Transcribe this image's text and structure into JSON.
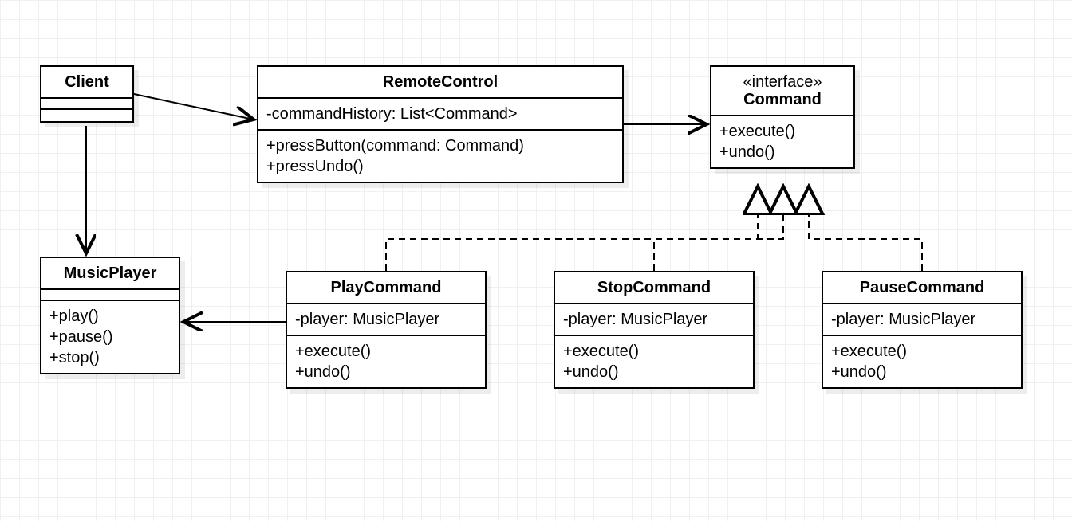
{
  "classes": {
    "client": {
      "name": "Client",
      "attributes": [],
      "methods": []
    },
    "remoteControl": {
      "name": "RemoteControl",
      "attributes": [
        "-commandHistory: List<Command>"
      ],
      "methods": [
        "+pressButton(command: Command)",
        "+pressUndo()"
      ]
    },
    "command": {
      "stereotype": "«interface»",
      "name": "Command",
      "attributes": [],
      "methods": [
        "+execute()",
        "+undo()"
      ]
    },
    "musicPlayer": {
      "name": "MusicPlayer",
      "attributes": [],
      "methods": [
        "+play()",
        "+pause()",
        "+stop()"
      ]
    },
    "playCommand": {
      "name": "PlayCommand",
      "attributes": [
        "-player: MusicPlayer"
      ],
      "methods": [
        "+execute()",
        "+undo()"
      ]
    },
    "stopCommand": {
      "name": "StopCommand",
      "attributes": [
        "-player: MusicPlayer"
      ],
      "methods": [
        "+execute()",
        "+undo()"
      ]
    },
    "pauseCommand": {
      "name": "PauseCommand",
      "attributes": [
        "-player: MusicPlayer"
      ],
      "methods": [
        "+execute()",
        "+undo()"
      ]
    }
  },
  "relationships": [
    {
      "from": "Client",
      "to": "RemoteControl",
      "type": "association",
      "style": "solid-open"
    },
    {
      "from": "Client",
      "to": "MusicPlayer",
      "type": "association",
      "style": "solid-open"
    },
    {
      "from": "RemoteControl",
      "to": "Command",
      "type": "association",
      "style": "solid-open"
    },
    {
      "from": "PlayCommand",
      "to": "MusicPlayer",
      "type": "association",
      "style": "solid-open"
    },
    {
      "from": "PlayCommand",
      "to": "Command",
      "type": "realization",
      "style": "dashed-hollow"
    },
    {
      "from": "StopCommand",
      "to": "Command",
      "type": "realization",
      "style": "dashed-hollow"
    },
    {
      "from": "PauseCommand",
      "to": "Command",
      "type": "realization",
      "style": "dashed-hollow"
    }
  ]
}
